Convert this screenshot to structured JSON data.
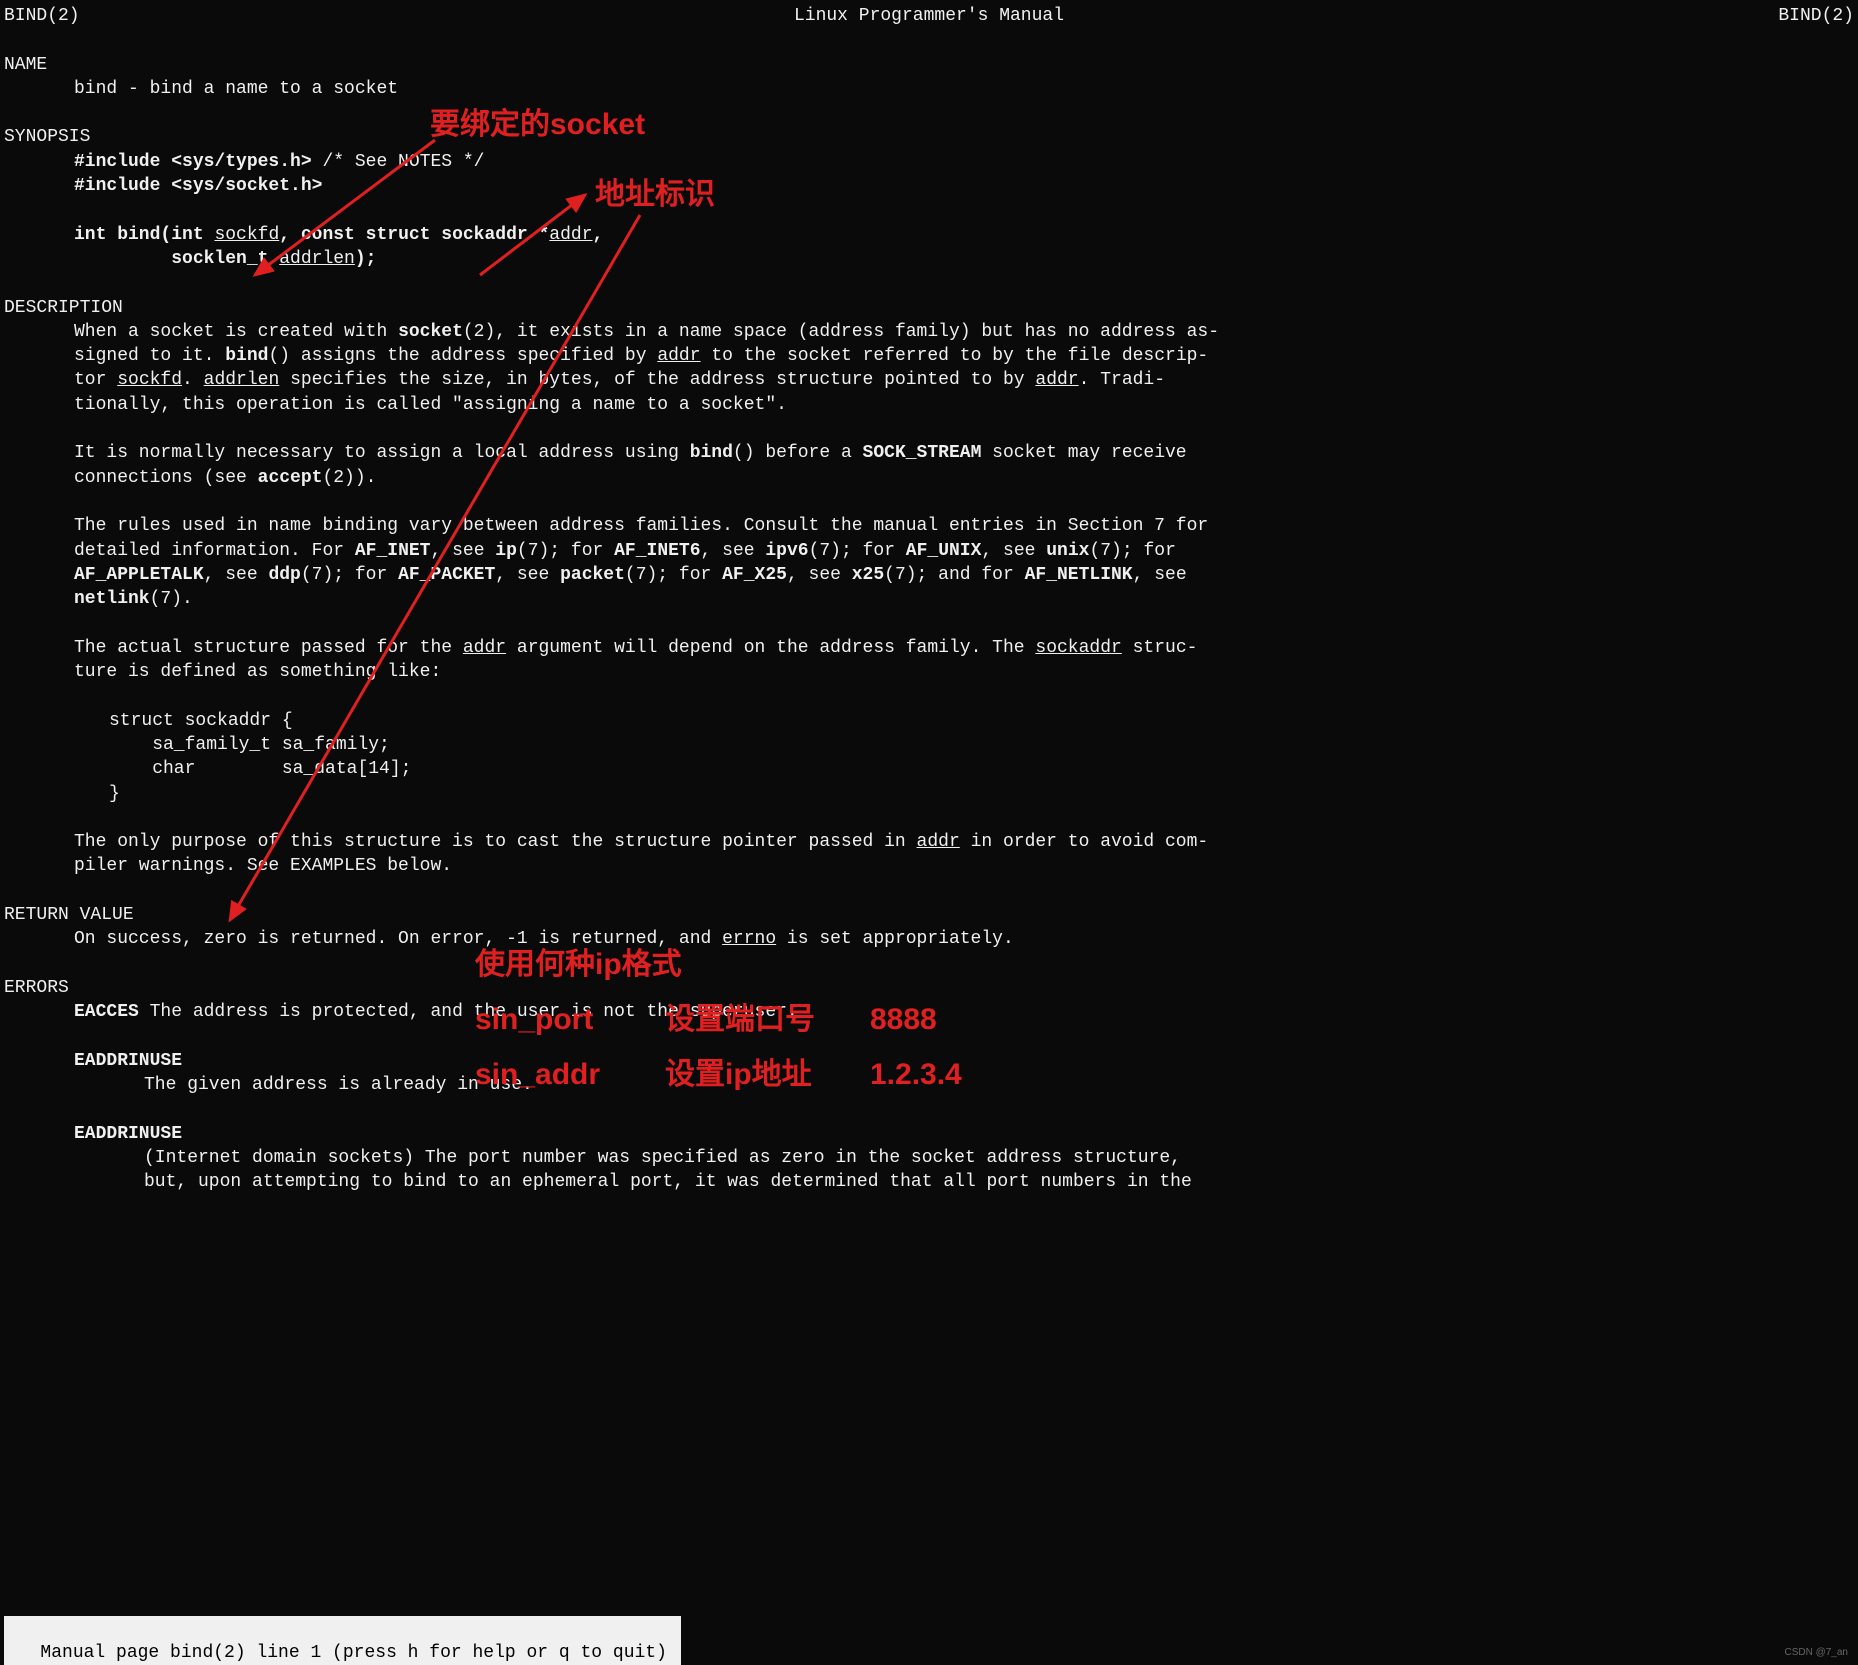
{
  "header": {
    "left": "BIND(2)",
    "center": "Linux Programmer's Manual",
    "right": "BIND(2)"
  },
  "name": {
    "title": "NAME",
    "line": "bind - bind a name to a socket"
  },
  "synopsis": {
    "title": "SYNOPSIS",
    "inc1_pre": "#include <sys/types.h>",
    "inc1_comment": "          /* See NOTES */",
    "inc2": "#include <sys/socket.h>",
    "fn_pre": "int bind(int ",
    "fn_sockfd": "sockfd",
    "fn_mid": ", const struct sockaddr *",
    "fn_addr": "addr",
    "fn_post": ",",
    "fn_line2_pre": "         socklen_t ",
    "fn_addrlen": "addrlen",
    "fn_line2_post": ");"
  },
  "description": {
    "title": "DESCRIPTION",
    "p1_a": "When a socket is created with ",
    "p1_socket": "socket",
    "p1_b": "(2), it exists in a name space (address family) but has no address as‐",
    "p1_c": "signed to it.  ",
    "p1_bind": "bind",
    "p1_d": "() assigns the address specified by ",
    "p1_addr1": "addr",
    "p1_e": " to the socket referred to by the file descrip‐",
    "p1_f": "tor  ",
    "p1_sockfd": "sockfd",
    "p1_g": ".   ",
    "p1_addrlen": "addrlen",
    "p1_h": "  specifies the size, in bytes, of the address structure pointed to by ",
    "p1_addr2": "addr",
    "p1_i": ".   Tradi‐",
    "p1_j": "tionally, this operation is called  \"assigning a name to a socket\".",
    "p2_a": "It is normally necessary to assign a local address using ",
    "p2_bind": "bind",
    "p2_b": "() before a ",
    "p2_sock": "SOCK_STREAM",
    "p2_c": "  socket  may  receive",
    "p2_d": "connections (see ",
    "p2_accept": "accept",
    "p2_e": "(2)).",
    "p3_a": "The rules used in name binding vary between address families.  Consult the manual entries in Section 7 for",
    "p3_b": "detailed information.  For ",
    "p3_afinet": "AF_INET",
    "p3_c": ", see ",
    "p3_ip": "ip",
    "p3_d": "(7); for ",
    "p3_afinet6": "AF_INET6",
    "p3_e": ", see ",
    "p3_ipv6": "ipv6",
    "p3_f": "(7); for ",
    "p3_afunix": "AF_UNIX",
    "p3_g": ",  see  ",
    "p3_unix": "unix",
    "p3_h": "(7);  for",
    "p3_i_afapple": "AF_APPLETALK",
    "p3_j": ",  see  ",
    "p3_ddp": "ddp",
    "p3_k": "(7);  for ",
    "p3_afpacket": "AF_PACKET",
    "p3_l": ", see ",
    "p3_packet": "packet",
    "p3_m": "(7); for ",
    "p3_afx25": "AF_X25",
    "p3_n": ", see ",
    "p3_x25": "x25",
    "p3_o": "(7); and for ",
    "p3_afnetlink": "AF_NETLINK",
    "p3_p": ", see",
    "p3_netlink": "netlink",
    "p3_q": "(7).",
    "p4_a": "The actual structure passed for the ",
    "p4_addr": "addr",
    "p4_b": " argument will depend on the address family.  The ",
    "p4_sockaddr": "sockaddr",
    "p4_c": "  struc‐",
    "p4_d": "ture is defined as something like:",
    "struct1": "struct sockaddr {",
    "struct2": "    sa_family_t sa_family;",
    "struct3": "    char        sa_data[14];",
    "struct4": "}",
    "p5_a": "The  only purpose of this structure is to cast the structure pointer passed in ",
    "p5_addr": "addr",
    "p5_b": " in order to avoid com‐",
    "p5_c": "piler warnings.  See EXAMPLES below."
  },
  "return": {
    "title": "RETURN VALUE",
    "line_a": "On success, zero is returned.  On error, -1 is returned, and ",
    "errno": "errno",
    "line_b": " is set appropriately."
  },
  "errors": {
    "title": "ERRORS",
    "eacces": "EACCES",
    "eacces_txt": " The address is protected, and the user is not the superuser.",
    "eaddr1": "EADDRINUSE",
    "eaddr1_txt": "The given address is already in use.",
    "eaddr2": "EADDRINUSE",
    "eaddr2_l1": "(Internet domain sockets) The port number was specified as zero in the  socket  address  structure,",
    "eaddr2_l2": "but,  upon  attempting to bind to an ephemeral port, it was determined that all port numbers in the"
  },
  "status": " Manual page bind(2) line 1 (press h for help or q to quit)",
  "annotations": {
    "a1": "要绑定的socket",
    "a2": "地址标识",
    "a3": "使用何种ip格式",
    "a4_l": "sin_port",
    "a4_m": "设置端口号",
    "a4_r": "8888",
    "a5_l": "sin_addr",
    "a5_m": "设置ip地址",
    "a5_r": "1.2.3.4"
  },
  "watermark": "CSDN @7_an"
}
